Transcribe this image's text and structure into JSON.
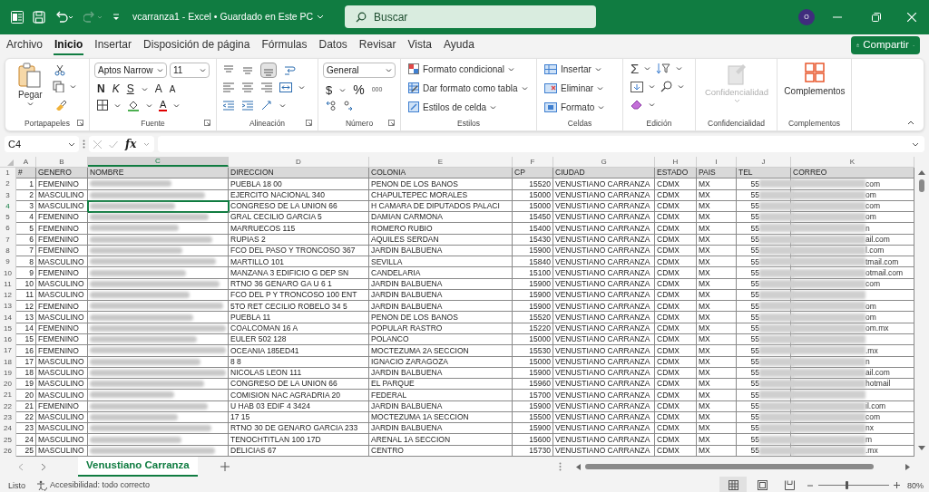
{
  "title_bar": {
    "document_title": "vcarranza1  -  Excel • Guardado en Este PC",
    "search_placeholder": "Buscar",
    "avatar_initial": "O"
  },
  "menu_tabs": [
    {
      "label": "Archivo",
      "selected": false
    },
    {
      "label": "Inicio",
      "selected": true
    },
    {
      "label": "Insertar",
      "selected": false
    },
    {
      "label": "Disposición de página",
      "selected": false
    },
    {
      "label": "Fórmulas",
      "selected": false
    },
    {
      "label": "Datos",
      "selected": false
    },
    {
      "label": "Revisar",
      "selected": false
    },
    {
      "label": "Vista",
      "selected": false
    },
    {
      "label": "Ayuda",
      "selected": false
    }
  ],
  "share_button": "Compartir",
  "ribbon": {
    "portapapeles": {
      "label": "Portapapeles",
      "paste": "Pegar"
    },
    "fuente": {
      "label": "Fuente",
      "font": "Aptos Narrow",
      "size": "11",
      "bold": "N",
      "italic": "K",
      "underline": "S",
      "grow": "A",
      "shrink": "A",
      "font_color": "A"
    },
    "alineacion": {
      "label": "Alineación"
    },
    "numero": {
      "label": "Número",
      "format": "General",
      "currency": "$",
      "percent": "%",
      "thousands": "000"
    },
    "estilos": {
      "label": "Estilos",
      "items": [
        "Formato condicional",
        "Dar formato como tabla",
        "Estilos de celda"
      ]
    },
    "celdas": {
      "label": "Celdas",
      "items": [
        "Insertar",
        "Eliminar",
        "Formato"
      ]
    },
    "edicion": {
      "label": "Edición",
      "sum": "Σ"
    },
    "confidencialidad": {
      "label": "Confidencialidad",
      "button": "Confidencialidad",
      "disabled": true
    },
    "complementos": {
      "label": "Complementos",
      "button": "Complementos"
    }
  },
  "formula_bar": {
    "name_box": "C4",
    "fx": "fx"
  },
  "columns": [
    {
      "letter": "A",
      "selected": false
    },
    {
      "letter": "B",
      "selected": false
    },
    {
      "letter": "C",
      "selected": true
    },
    {
      "letter": "D",
      "selected": false
    },
    {
      "letter": "E",
      "selected": false
    },
    {
      "letter": "F",
      "selected": false
    },
    {
      "letter": "G",
      "selected": false
    },
    {
      "letter": "H",
      "selected": false
    },
    {
      "letter": "I",
      "selected": false
    },
    {
      "letter": "J",
      "selected": false
    },
    {
      "letter": "K",
      "selected": false
    }
  ],
  "header_row": {
    "row": "1",
    "cells": [
      "#",
      "GENERO",
      "NOMBRE",
      "DIRECCION",
      "COLONIA",
      "CP",
      "CIUDAD",
      "ESTADO",
      "PAIS",
      "TEL",
      "CORREO"
    ]
  },
  "rows": [
    {
      "row": "2",
      "num": "1",
      "genero": "FEMENINO",
      "direccion": "PUEBLA 18 00",
      "colonia": "PENON DE LOS BANOS",
      "cp": "15520",
      "ciudad": "VENUSTIANO CARRANZA",
      "estado": "CDMX",
      "pais": "MX",
      "tel": "55",
      "correo": "com",
      "selected": false
    },
    {
      "row": "3",
      "num": "2",
      "genero": "MASCULINO",
      "direccion": "EJERCITO NACIONAL 340",
      "colonia": "CHAPULTEPEC MORALES",
      "cp": "15000",
      "ciudad": "VENUSTIANO CARRANZA",
      "estado": "CDMX",
      "pais": "MX",
      "tel": "55",
      "correo": "om",
      "selected": false
    },
    {
      "row": "4",
      "num": "3",
      "genero": "MASCULINO",
      "direccion": "CONGRESO DE LA UNION 66",
      "colonia": "H CAMARA DE DIPUTADOS PALACI",
      "cp": "15000",
      "ciudad": "VENUSTIANO CARRANZA",
      "estado": "CDMX",
      "pais": "MX",
      "tel": "55",
      "correo": "com",
      "selected": true
    },
    {
      "row": "5",
      "num": "4",
      "genero": "FEMENINO",
      "direccion": "GRAL CECILIO GARCIA 5",
      "colonia": "DAMIAN CARMONA",
      "cp": "15450",
      "ciudad": "VENUSTIANO CARRANZA",
      "estado": "CDMX",
      "pais": "MX",
      "tel": "55",
      "correo": "om",
      "selected": false
    },
    {
      "row": "6",
      "num": "5",
      "genero": "FEMENINO",
      "direccion": "MARRUECOS 115",
      "colonia": "ROMERO RUBIO",
      "cp": "15400",
      "ciudad": "VENUSTIANO CARRANZA",
      "estado": "CDMX",
      "pais": "MX",
      "tel": "55",
      "correo": "n",
      "selected": false
    },
    {
      "row": "7",
      "num": "6",
      "genero": "FEMENINO",
      "direccion": "RUPIAS 2",
      "colonia": "AQUILES SERDAN",
      "cp": "15430",
      "ciudad": "VENUSTIANO CARRANZA",
      "estado": "CDMX",
      "pais": "MX",
      "tel": "55",
      "correo": "ail.com",
      "selected": false
    },
    {
      "row": "8",
      "num": "7",
      "genero": "FEMENINO",
      "direccion": "FCO DEL PASO Y TRONCOSO 367",
      "colonia": "JARDIN BALBUENA",
      "cp": "15900",
      "ciudad": "VENUSTIANO CARRANZA",
      "estado": "CDMX",
      "pais": "MX",
      "tel": "55",
      "correo": "l.com",
      "selected": false
    },
    {
      "row": "9",
      "num": "8",
      "genero": "MASCULINO",
      "direccion": "MARTILLO 101",
      "colonia": "SEVILLA",
      "cp": "15840",
      "ciudad": "VENUSTIANO CARRANZA",
      "estado": "CDMX",
      "pais": "MX",
      "tel": "55",
      "correo": "tmail.com",
      "selected": false
    },
    {
      "row": "10",
      "num": "9",
      "genero": "FEMENINO",
      "direccion": "MANZANA 3 EDIFICIO G DEP SN",
      "colonia": "CANDELARIA",
      "cp": "15100",
      "ciudad": "VENUSTIANO CARRANZA",
      "estado": "CDMX",
      "pais": "MX",
      "tel": "55",
      "correo": "otmail.com",
      "selected": false
    },
    {
      "row": "11",
      "num": "10",
      "genero": "MASCULINO",
      "direccion": "RTNO 36 GENARO GA U 6 1",
      "colonia": "JARDIN BALBUENA",
      "cp": "15900",
      "ciudad": "VENUSTIANO CARRANZA",
      "estado": "CDMX",
      "pais": "MX",
      "tel": "55",
      "correo": "com",
      "selected": false
    },
    {
      "row": "12",
      "num": "11",
      "genero": "MASCULINO",
      "direccion": "FCO DEL P Y TRONCOSO 100 ENT",
      "colonia": "JARDIN BALBUENA",
      "cp": "15900",
      "ciudad": "VENUSTIANO CARRANZA",
      "estado": "CDMX",
      "pais": "MX",
      "tel": "55",
      "selected": false
    },
    {
      "row": "13",
      "num": "12",
      "genero": "FEMENINO",
      "direccion": "5TO RET CECILIO ROBELO 34 5",
      "colonia": "JARDIN BALBUENA",
      "cp": "15900",
      "ciudad": "VENUSTIANO CARRANZA",
      "estado": "CDMX",
      "pais": "MX",
      "tel": "55",
      "correo": "om",
      "selected": false
    },
    {
      "row": "14",
      "num": "13",
      "genero": "MASCULINO",
      "direccion": "PUEBLA 11",
      "colonia": "PENON DE LOS BANOS",
      "cp": "15520",
      "ciudad": "VENUSTIANO CARRANZA",
      "estado": "CDMX",
      "pais": "MX",
      "tel": "55",
      "correo": "om",
      "selected": false
    },
    {
      "row": "15",
      "num": "14",
      "genero": "FEMENINO",
      "direccion": "COALCOMAN 16 A",
      "colonia": "POPULAR RASTRO",
      "cp": "15220",
      "ciudad": "VENUSTIANO CARRANZA",
      "estado": "CDMX",
      "pais": "MX",
      "tel": "55",
      "correo": "om.mx",
      "selected": false
    },
    {
      "row": "16",
      "num": "15",
      "genero": "FEMENINO",
      "direccion": "EULER 502 128",
      "colonia": "POLANCO",
      "cp": "15000",
      "ciudad": "VENUSTIANO CARRANZA",
      "estado": "CDMX",
      "pais": "MX",
      "tel": "55",
      "selected": false
    },
    {
      "row": "17",
      "num": "16",
      "genero": "FEMENINO",
      "direccion": "OCEANIA 185ED41",
      "colonia": "MOCTEZUMA 2A SECCION",
      "cp": "15530",
      "ciudad": "VENUSTIANO CARRANZA",
      "estado": "CDMX",
      "pais": "MX",
      "tel": "55",
      "correo": ".mx",
      "selected": false
    },
    {
      "row": "18",
      "num": "17",
      "genero": "MASCULINO",
      "direccion": "8 8",
      "colonia": "IGNACIO ZARAGOZA",
      "cp": "15000",
      "ciudad": "VENUSTIANO CARRANZA",
      "estado": "CDMX",
      "pais": "MX",
      "tel": "55",
      "correo": "n",
      "selected": false
    },
    {
      "row": "19",
      "num": "18",
      "genero": "MASCULINO",
      "direccion": "NICOLAS LEON 111",
      "colonia": "JARDIN BALBUENA",
      "cp": "15900",
      "ciudad": "VENUSTIANO CARRANZA",
      "estado": "CDMX",
      "pais": "MX",
      "tel": "55",
      "correo": "ail.com",
      "selected": false
    },
    {
      "row": "20",
      "num": "19",
      "genero": "MASCULINO",
      "direccion": "CONGRESO DE LA UNION 66",
      "colonia": "EL PARQUE",
      "cp": "15960",
      "ciudad": "VENUSTIANO CARRANZA",
      "estado": "CDMX",
      "pais": "MX",
      "tel": "55",
      "correo": "hotmail",
      "selected": false
    },
    {
      "row": "21",
      "num": "20",
      "genero": "MASCULINO",
      "direccion": "COMISION NAC AGRADRIA 20",
      "colonia": "FEDERAL",
      "cp": "15700",
      "ciudad": "VENUSTIANO CARRANZA",
      "estado": "CDMX",
      "pais": "MX",
      "tel": "55",
      "selected": false
    },
    {
      "row": "22",
      "num": "21",
      "genero": "FEMENINO",
      "direccion": "U HAB 03 EDIF 4 3424",
      "colonia": "JARDIN BALBUENA",
      "cp": "15900",
      "ciudad": "VENUSTIANO CARRANZA",
      "estado": "CDMX",
      "pais": "MX",
      "tel": "55",
      "correo": "il.com",
      "selected": false
    },
    {
      "row": "23",
      "num": "22",
      "genero": "MASCULINO",
      "direccion": "17 15",
      "colonia": "MOCTEZUMA 1A SECCION",
      "cp": "15500",
      "ciudad": "VENUSTIANO CARRANZA",
      "estado": "CDMX",
      "pais": "MX",
      "tel": "55",
      "correo": "com",
      "selected": false
    },
    {
      "row": "24",
      "num": "23",
      "genero": "MASCULINO",
      "direccion": "RTNO 30 DE GENARO GARCIA 233",
      "colonia": "JARDIN BALBUENA",
      "cp": "15900",
      "ciudad": "VENUSTIANO CARRANZA",
      "estado": "CDMX",
      "pais": "MX",
      "tel": "55",
      "correo": "nx",
      "selected": false
    },
    {
      "row": "25",
      "num": "24",
      "genero": "MASCULINO",
      "direccion": "TENOCHTITLAN 100 17D",
      "colonia": "ARENAL 1A SECCION",
      "cp": "15600",
      "ciudad": "VENUSTIANO CARRANZA",
      "estado": "CDMX",
      "pais": "MX",
      "tel": "55",
      "correo": "m",
      "selected": false
    },
    {
      "row": "26",
      "num": "25",
      "genero": "MASCULINO",
      "direccion": "DELICIAS 67",
      "colonia": "CENTRO",
      "cp": "15730",
      "ciudad": "VENUSTIANO CARRANZA",
      "estado": "CDMX",
      "pais": "MX",
      "tel": "55",
      "correo": ".mx",
      "selected": false
    }
  ],
  "sheet_tabs": [
    {
      "label": "Venustiano Carranza",
      "selected": true
    }
  ],
  "status_bar": {
    "ready": "Listo",
    "accessibility": "Accesibilidad: todo correcto",
    "zoom": "80%",
    "zoom_slider": {
      "level": 0.4
    }
  }
}
